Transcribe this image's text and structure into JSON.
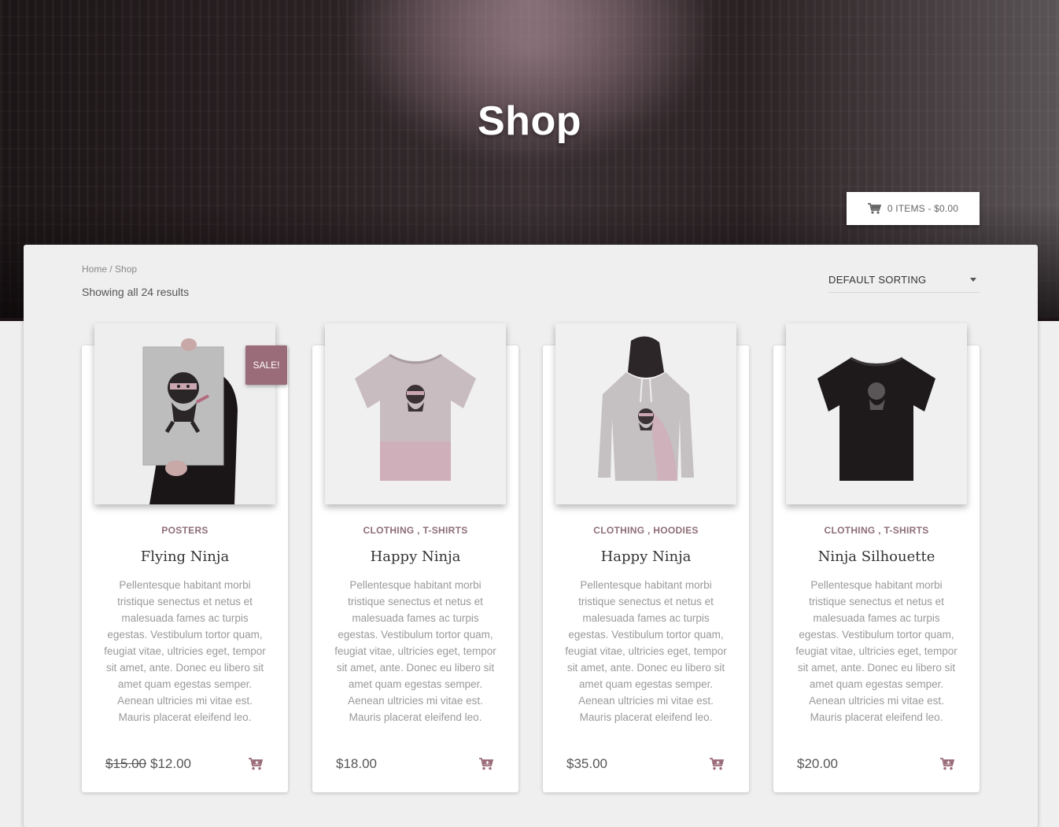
{
  "hero": {
    "title": "Shop"
  },
  "cart": {
    "label": "0 ITEMS - $0.00",
    "icon": "shopping-cart-icon"
  },
  "breadcrumb": {
    "home": "Home",
    "separator": " / ",
    "current": "Shop"
  },
  "results": {
    "text": "Showing all 24 results"
  },
  "sorting": {
    "selected": "DEFAULT SORTING"
  },
  "colors": {
    "accent": "#9a6b78",
    "category": "#8e6e77"
  },
  "products": [
    {
      "categories": [
        "POSTERS"
      ],
      "category_text": "POSTERS",
      "title": "Flying Ninja",
      "description": "Pellentesque habitant morbi tristique senectus et netus et malesuada fames ac turpis egestas. Vestibulum tortor quam, feugiat vitae, ultricies eget, tempor sit amet, ante. Donec eu libero sit amet quam egestas semper. Aenean ultricies mi vitae est. Mauris placerat eleifend leo.",
      "old_price": "$15.00",
      "price": "$12.00",
      "sale_badge": "SALE!",
      "image": "poster-image"
    },
    {
      "categories": [
        "CLOTHING",
        "T-SHIRTS"
      ],
      "category_text": "CLOTHING , T-SHIRTS",
      "title": "Happy Ninja",
      "description": "Pellentesque habitant morbi tristique senectus et netus et malesuada fames ac turpis egestas. Vestibulum tortor quam, feugiat vitae, ultricies eget, tempor sit amet, ante. Donec eu libero sit amet quam egestas semper. Aenean ultricies mi vitae est. Mauris placerat eleifend leo.",
      "price": "$18.00",
      "image": "tshirt-image"
    },
    {
      "categories": [
        "CLOTHING",
        "HOODIES"
      ],
      "category_text": "CLOTHING , HOODIES",
      "title": "Happy Ninja",
      "description": "Pellentesque habitant morbi tristique senectus et netus et malesuada fames ac turpis egestas. Vestibulum tortor quam, feugiat vitae, ultricies eget, tempor sit amet, ante. Donec eu libero sit amet quam egestas semper. Aenean ultricies mi vitae est. Mauris placerat eleifend leo.",
      "price": "$35.00",
      "image": "hoodie-image"
    },
    {
      "categories": [
        "CLOTHING",
        "T-SHIRTS"
      ],
      "category_text": "CLOTHING , T-SHIRTS",
      "title": "Ninja Silhouette",
      "description": "Pellentesque habitant morbi tristique senectus et netus et malesuada fames ac turpis egestas. Vestibulum tortor quam, feugiat vitae, ultricies eget, tempor sit amet, ante. Donec eu libero sit amet quam egestas semper. Aenean ultricies mi vitae est. Mauris placerat eleifend leo.",
      "price": "$20.00",
      "image": "black-tshirt-image"
    }
  ]
}
